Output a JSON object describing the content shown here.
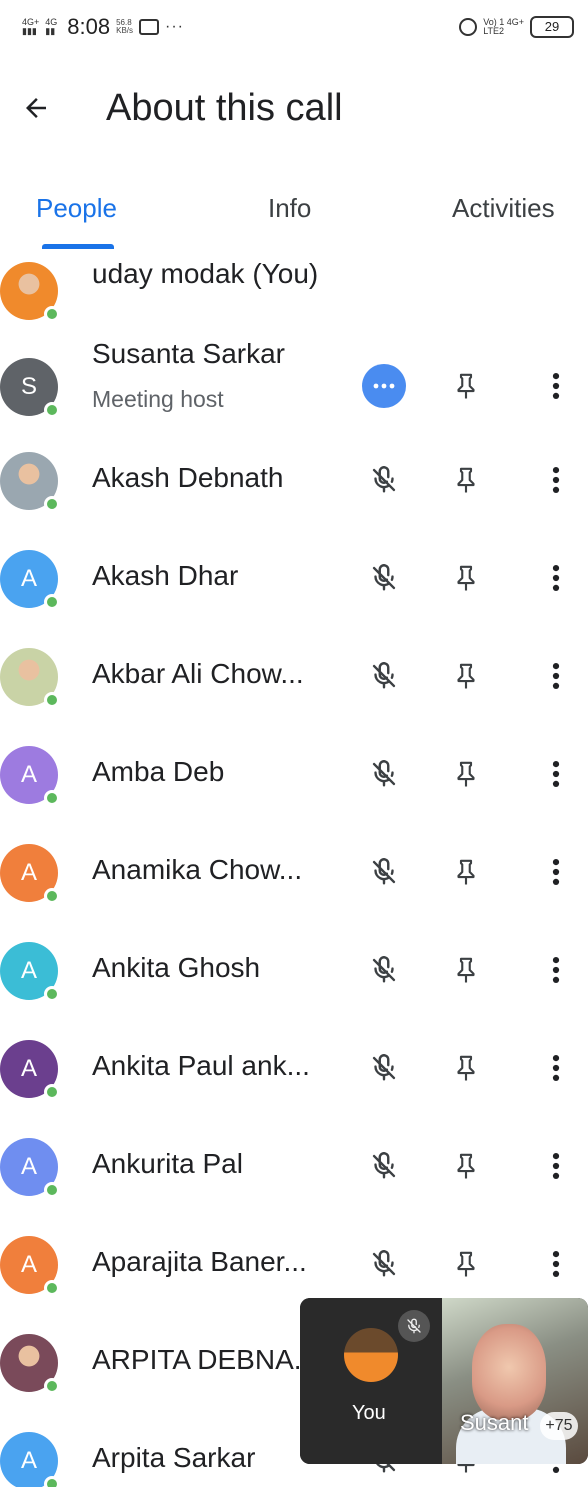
{
  "status_bar": {
    "sim1": "4G+",
    "sim2": "4G",
    "time": "8:08",
    "speed": "56.8",
    "speed_unit": "KB/s",
    "more": "···",
    "net": "Vo) 1 4G+",
    "net2": "LTE2",
    "battery": "29"
  },
  "header": {
    "title": "About this call"
  },
  "tabs": [
    {
      "label": "People",
      "active": true
    },
    {
      "label": "Info",
      "active": false
    },
    {
      "label": "Activities",
      "active": false
    }
  ],
  "participants": [
    {
      "name": "uday modak (You)",
      "avatar_letter": "",
      "avatar_color": "#f08a2c",
      "photo": true
    },
    {
      "name": "Susanta Sarkar",
      "subtitle": "Meeting host",
      "avatar_letter": "S",
      "avatar_color": "#5f6368",
      "host": true
    },
    {
      "name": "Akash Debnath",
      "avatar_letter": "",
      "avatar_color": "#9aa7b0",
      "photo": true
    },
    {
      "name": "Akash Dhar",
      "avatar_letter": "A",
      "avatar_color": "#4aa3f0"
    },
    {
      "name": "Akbar Ali Chow...",
      "avatar_letter": "",
      "avatar_color": "#c9d3a6",
      "photo": true
    },
    {
      "name": "Amba Deb",
      "avatar_letter": "A",
      "avatar_color": "#9d7be0"
    },
    {
      "name": "Anamika Chow...",
      "avatar_letter": "A",
      "avatar_color": "#f07f3c"
    },
    {
      "name": "Ankita Ghosh",
      "avatar_letter": "A",
      "avatar_color": "#3bbdd6"
    },
    {
      "name": "Ankita Paul ank...",
      "avatar_letter": "A",
      "avatar_color": "#6b3f8e"
    },
    {
      "name": "Ankurita Pal",
      "avatar_letter": "A",
      "avatar_color": "#6f8ef0"
    },
    {
      "name": "Aparajita Baner...",
      "avatar_letter": "A",
      "avatar_color": "#f07f3c"
    },
    {
      "name": "ARPITA DEBNA...",
      "avatar_letter": "",
      "avatar_color": "#7a4a5a",
      "photo": true
    },
    {
      "name": "Arpita Sarkar",
      "avatar_letter": "A",
      "avatar_color": "#4aa3f0"
    }
  ],
  "pip": {
    "self_label": "You",
    "remote_label": "Susant",
    "count": "+75"
  }
}
